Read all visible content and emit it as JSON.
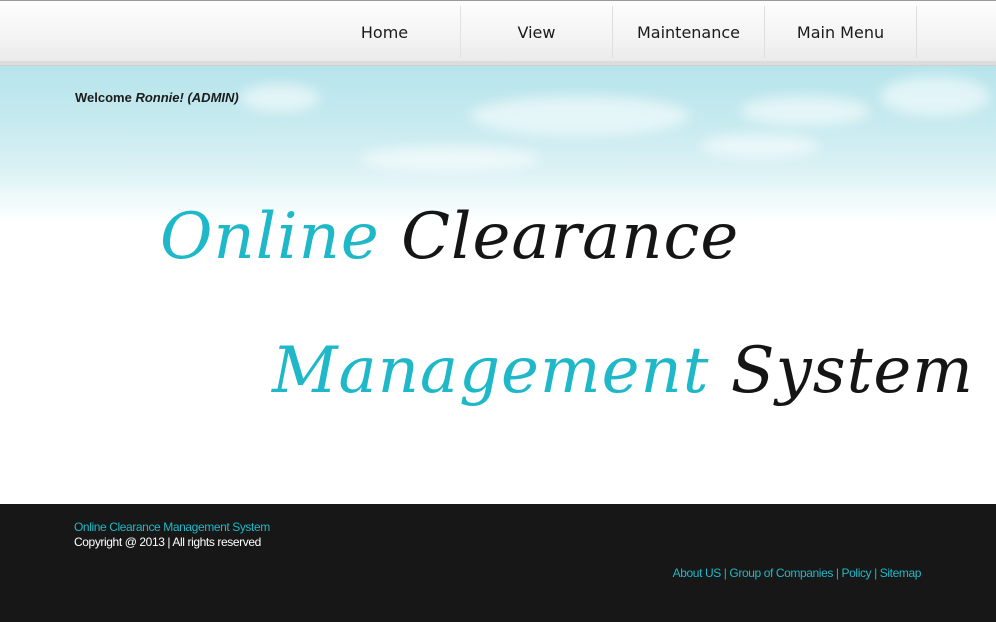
{
  "nav": {
    "items": [
      {
        "label": "Home"
      },
      {
        "label": "View"
      },
      {
        "label": "Maintenance"
      },
      {
        "label": "Main Menu"
      }
    ]
  },
  "header": {
    "welcome_prefix": "Welcome",
    "welcome_user": "Ronnie! (ADMIN)"
  },
  "hero": {
    "title_line1_a": "Online",
    "title_line1_b": "Clearance",
    "title_line2_a": "Management",
    "title_line2_b": "System"
  },
  "footer": {
    "site_name": "Online Clearance Management System",
    "copyright": "Copyright @ 2013 | All rights reserved",
    "links": [
      {
        "label": "About US"
      },
      {
        "label": "Group of Companies"
      },
      {
        "label": "Policy"
      },
      {
        "label": "Sitemap"
      }
    ],
    "separator": "|"
  },
  "colors": {
    "accent": "#1fb8c8",
    "footer_bg": "#171717",
    "sky_top": "#b6e4eb"
  }
}
